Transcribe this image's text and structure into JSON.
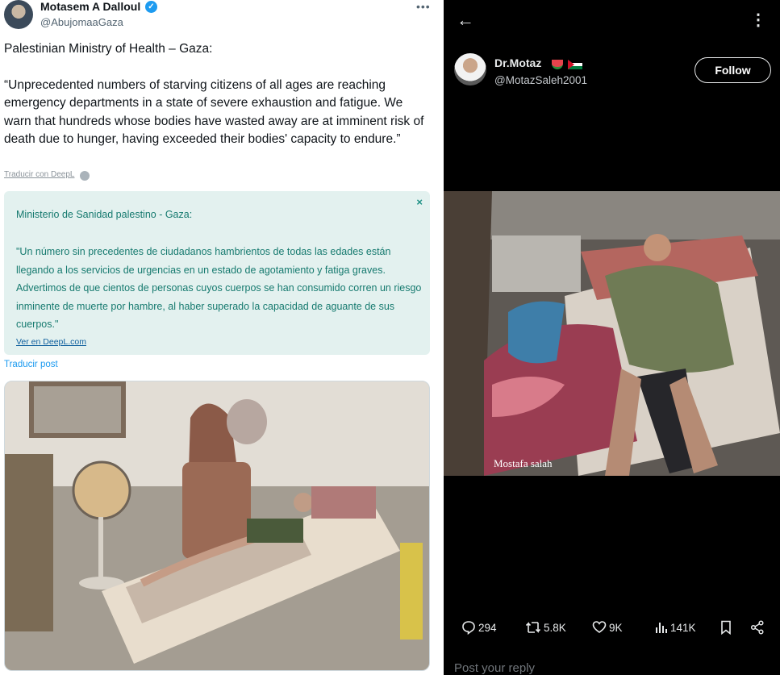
{
  "left_tweet": {
    "author_name": "Motasem A Dalloul",
    "author_handle": "@AbujomaaGaza",
    "more_icon": "more-horizontal-icon",
    "verified_icon": "verified-badge-icon",
    "text_heading": "Palestinian Ministry of Health – Gaza:",
    "text_body": "“Unprecedented numbers of starving citizens of all ages are reaching emergency departments in a state of severe exhaustion and fatigue. We warn that hundreds whose bodies have wasted away are at imminent risk of death due to hunger, having exceeded their bodies' capacity to endure.”",
    "deepl_translate": "Traducir con DeepL",
    "translation": {
      "close": "×",
      "title": "Ministerio de Sanidad palestino - Gaza:",
      "text": "\"Un número sin precedentes de ciudadanos hambrientos de todas las edades están llegando a los servicios de urgencias en un estado de agotamiento y fatiga graves. Advertimos de que cientos de personas cuyos cuerpos se han consumido corren un riesgo inminente de muerte por hambre, al haber superado la capacidad de aguante de sus cuerpos.\"",
      "link": "Ver en DeepL.com"
    },
    "translate_post": "Traducir post"
  },
  "right_post": {
    "author_name": "Dr.Motaz",
    "author_handle": "@MotazSaleh2001",
    "follow_label": "Follow",
    "back_icon": "back-arrow-icon",
    "more_icon": "more-vertical-icon",
    "photo_caption": "Mostafa salah",
    "actions": {
      "replies": "294",
      "reposts": "5.8K",
      "likes": "9K",
      "views": "141K"
    },
    "reply_placeholder": "Post your reply"
  },
  "colors": {
    "x_blue": "#1d9bf0",
    "translation_bg": "#e3f1ef",
    "translation_text": "#167a6f",
    "dark_bg": "#000000"
  }
}
